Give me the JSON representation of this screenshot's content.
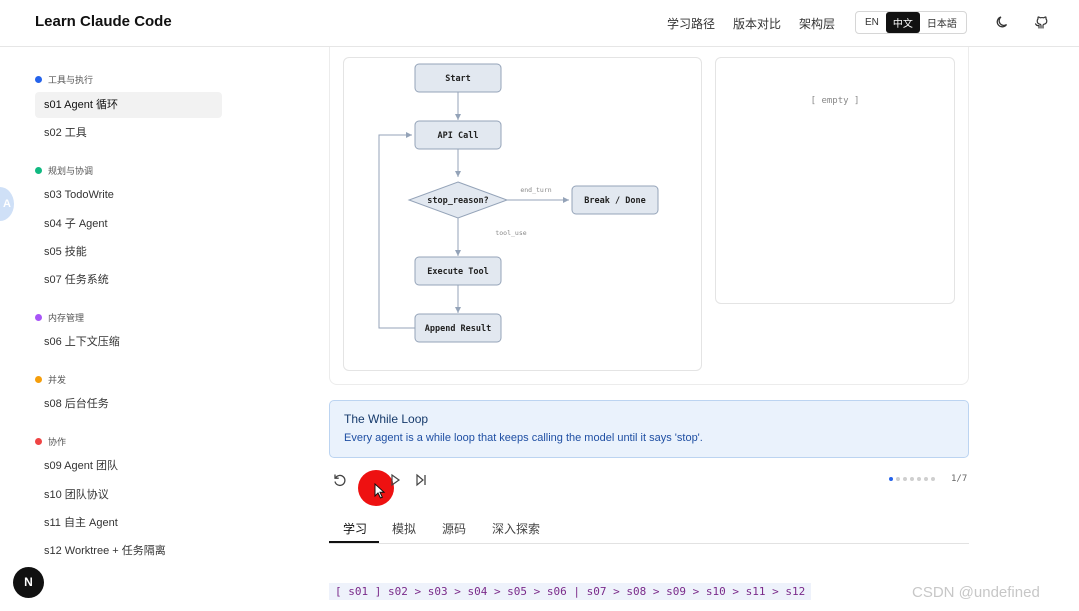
{
  "header": {
    "brand": "Learn Claude Code",
    "nav": [
      "学习路径",
      "版本对比",
      "架构层"
    ],
    "languages": [
      {
        "label": "EN",
        "active": false
      },
      {
        "label": "中文",
        "active": true
      },
      {
        "label": "日本語",
        "active": false
      }
    ],
    "icons": [
      "moon-icon",
      "github-icon"
    ]
  },
  "sidebar": {
    "groups": [
      {
        "label": "工具与执行",
        "color": "#2563eb",
        "items": [
          {
            "label": "s01 Agent 循环",
            "active": true
          },
          {
            "label": "s02 工具",
            "active": false
          }
        ]
      },
      {
        "label": "规划与协调",
        "color": "#10b981",
        "items": [
          {
            "label": "s03 TodoWrite",
            "active": false
          },
          {
            "label": "s04 子 Agent",
            "active": false
          },
          {
            "label": "s05 技能",
            "active": false
          },
          {
            "label": "s07 任务系统",
            "active": false
          }
        ]
      },
      {
        "label": "内存管理",
        "color": "#a855f7",
        "items": [
          {
            "label": "s06 上下文压缩",
            "active": false
          }
        ]
      },
      {
        "label": "并发",
        "color": "#f59e0b",
        "items": [
          {
            "label": "s08 后台任务",
            "active": false
          }
        ]
      },
      {
        "label": "协作",
        "color": "#ef4444",
        "items": [
          {
            "label": "s09 Agent 团队",
            "active": false
          },
          {
            "label": "s10 团队协议",
            "active": false
          },
          {
            "label": "s11 自主 Agent",
            "active": false
          },
          {
            "label": "s12 Worktree + 任务隔离",
            "active": false
          }
        ]
      }
    ],
    "edge_badge": "A",
    "bottom_badge": "N"
  },
  "flowchart": {
    "nodes": {
      "start": "Start",
      "api_call": "API Call",
      "decision": "stop_reason?",
      "done": "Break / Done",
      "execute": "Execute Tool",
      "append": "Append Result"
    },
    "edges": {
      "end_turn": "end_turn",
      "tool_use": "tool_use"
    }
  },
  "side_panel": {
    "empty": "[ empty ]"
  },
  "info": {
    "title": "The While Loop",
    "desc": "Every agent is a while loop that keeps calling the model until it says 'stop'."
  },
  "player": {
    "step_current": 1,
    "step_total": 7,
    "step_label": "1/7"
  },
  "tabs": [
    {
      "label": "学习",
      "active": true
    },
    {
      "label": "模拟",
      "active": false
    },
    {
      "label": "源码",
      "active": false
    },
    {
      "label": "深入探索",
      "active": false
    }
  ],
  "crumbs": "[ s01 ] s02 > s03 > s04 > s05 > s06 | s07 > s08 > s09 > s10 > s11 > s12",
  "watermark": "CSDN @undefined"
}
